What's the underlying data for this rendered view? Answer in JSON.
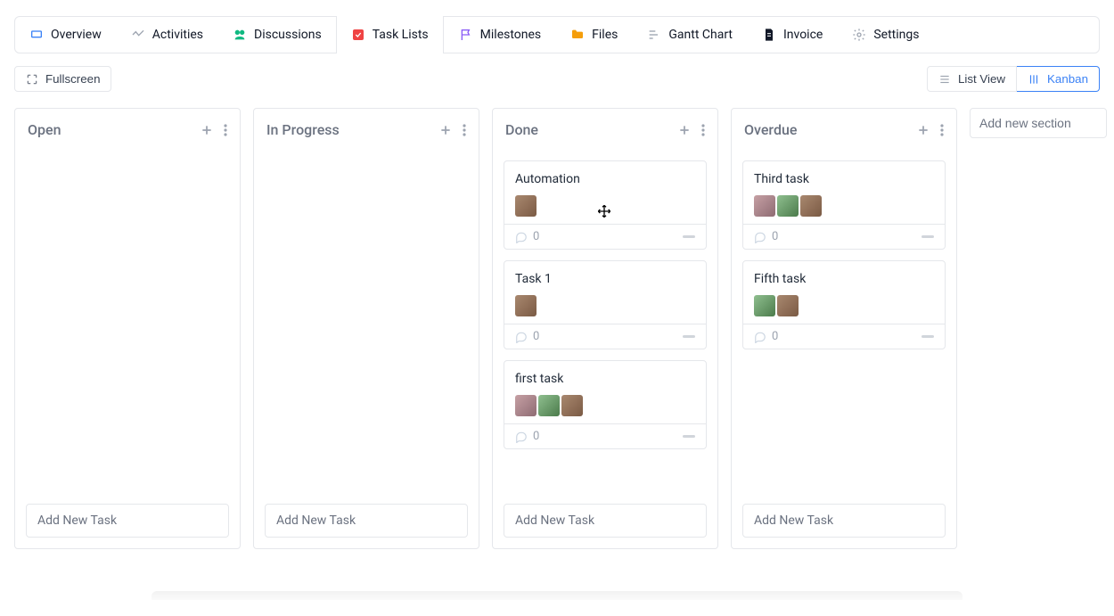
{
  "tabs": [
    {
      "label": "Overview",
      "icon": "overview",
      "color": "#3b82f6"
    },
    {
      "label": "Activities",
      "icon": "activities",
      "color": "#9ca3af"
    },
    {
      "label": "Discussions",
      "icon": "discussions",
      "color": "#10b981"
    },
    {
      "label": "Task Lists",
      "icon": "task-lists",
      "color": "#ef4444",
      "active": true
    },
    {
      "label": "Milestones",
      "icon": "milestones",
      "color": "#8b5cf6"
    },
    {
      "label": "Files",
      "icon": "files",
      "color": "#f59e0b"
    },
    {
      "label": "Gantt Chart",
      "icon": "gantt",
      "color": "#9ca3af"
    },
    {
      "label": "Invoice",
      "icon": "invoice",
      "color": "#111827"
    },
    {
      "label": "Settings",
      "icon": "settings",
      "color": "#9ca3af"
    }
  ],
  "toolbar": {
    "fullscreen_label": "Fullscreen",
    "list_view_label": "List View",
    "kanban_label": "Kanban"
  },
  "board": {
    "add_task_label": "Add New Task",
    "new_section_placeholder": "Add new section",
    "columns": [
      {
        "title": "Open",
        "cards": []
      },
      {
        "title": "In Progress",
        "cards": []
      },
      {
        "title": "Done",
        "cards": [
          {
            "title": "Automation",
            "avatars": [
              "bug"
            ],
            "comments": 0
          },
          {
            "title": "Task 1",
            "avatars": [
              "bug"
            ],
            "comments": 0
          },
          {
            "title": "first task",
            "avatars": [
              "person",
              "dragon",
              "bug"
            ],
            "comments": 0
          }
        ]
      },
      {
        "title": "Overdue",
        "cards": [
          {
            "title": "Third task",
            "avatars": [
              "person",
              "dragon",
              "bug"
            ],
            "comments": 0
          },
          {
            "title": "Fifth task",
            "avatars": [
              "dragon",
              "bug"
            ],
            "comments": 0
          }
        ]
      }
    ]
  }
}
